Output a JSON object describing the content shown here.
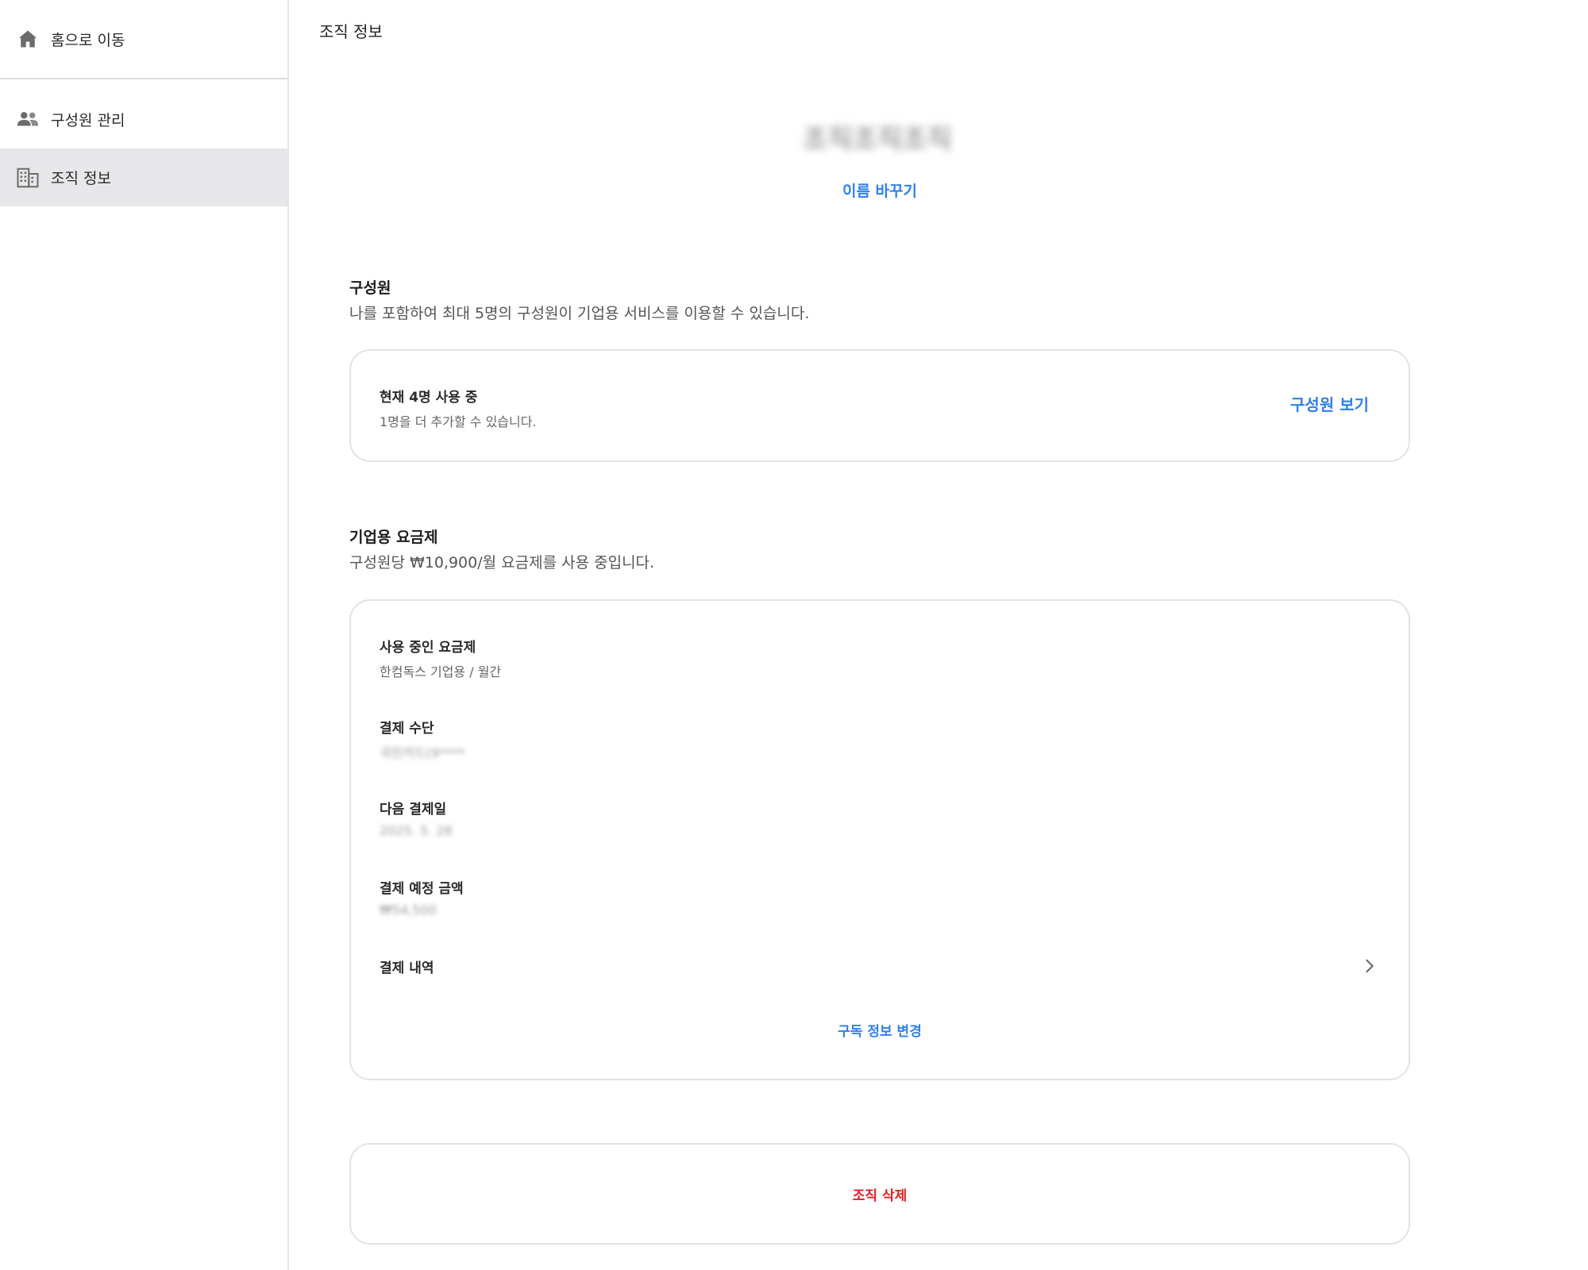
{
  "sidebar": {
    "items": [
      {
        "label": "홈으로 이동",
        "icon": "home-icon"
      },
      {
        "label": "구성원 관리",
        "icon": "people-icon"
      },
      {
        "label": "조직 정보",
        "icon": "building-icon",
        "active": true
      }
    ]
  },
  "header": {
    "title": "조직 정보"
  },
  "org": {
    "name": "조직조직조직",
    "rename_label": "이름 바꾸기"
  },
  "members_section": {
    "title": "구성원",
    "description": "나를 포함하여 최대 5명의 구성원이 기업용 서비스를 이용할 수 있습니다.",
    "current_usage": "현재 4명 사용 중",
    "remaining": "1명을 더 추가할 수 있습니다.",
    "view_label": "구성원 보기"
  },
  "plan_section": {
    "title": "기업용 요금제",
    "description": "구성원당 ₩10,900/월 요금제를 사용 중입니다.",
    "rows": [
      {
        "label": "사용 중인 요금제",
        "value": "한컴독스 기업용 / 월간",
        "blurred": false
      },
      {
        "label": "결제 수단",
        "value": "국민카드(9****",
        "blurred": true
      },
      {
        "label": "다음 결제일",
        "value": "2025. 5. 28",
        "blurred": true
      },
      {
        "label": "결제 예정 금액",
        "value": "₩54,500",
        "blurred": true
      }
    ],
    "history_label": "결제 내역",
    "change_label": "구독 정보 변경"
  },
  "danger": {
    "delete_label": "조직 삭제"
  },
  "colors": {
    "accent": "#2f80ed",
    "danger": "#e02020",
    "sidebar_active": "#e7e7ea",
    "border": "#e3e3e3"
  }
}
